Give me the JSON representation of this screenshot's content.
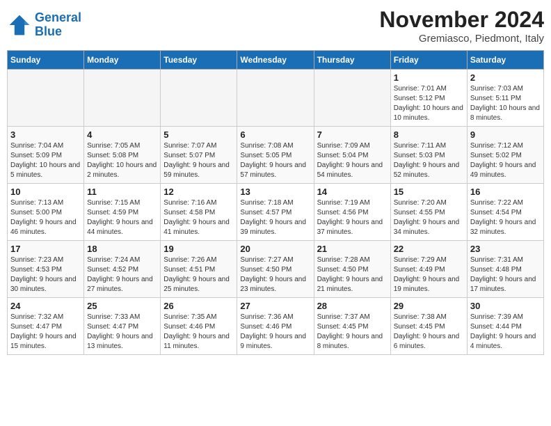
{
  "logo": {
    "line1": "General",
    "line2": "Blue"
  },
  "title": "November 2024",
  "subtitle": "Gremiasco, Piedmont, Italy",
  "weekdays": [
    "Sunday",
    "Monday",
    "Tuesday",
    "Wednesday",
    "Thursday",
    "Friday",
    "Saturday"
  ],
  "weeks": [
    [
      {
        "day": "",
        "info": ""
      },
      {
        "day": "",
        "info": ""
      },
      {
        "day": "",
        "info": ""
      },
      {
        "day": "",
        "info": ""
      },
      {
        "day": "",
        "info": ""
      },
      {
        "day": "1",
        "info": "Sunrise: 7:01 AM\nSunset: 5:12 PM\nDaylight: 10 hours and 10 minutes."
      },
      {
        "day": "2",
        "info": "Sunrise: 7:03 AM\nSunset: 5:11 PM\nDaylight: 10 hours and 8 minutes."
      }
    ],
    [
      {
        "day": "3",
        "info": "Sunrise: 7:04 AM\nSunset: 5:09 PM\nDaylight: 10 hours and 5 minutes."
      },
      {
        "day": "4",
        "info": "Sunrise: 7:05 AM\nSunset: 5:08 PM\nDaylight: 10 hours and 2 minutes."
      },
      {
        "day": "5",
        "info": "Sunrise: 7:07 AM\nSunset: 5:07 PM\nDaylight: 9 hours and 59 minutes."
      },
      {
        "day": "6",
        "info": "Sunrise: 7:08 AM\nSunset: 5:05 PM\nDaylight: 9 hours and 57 minutes."
      },
      {
        "day": "7",
        "info": "Sunrise: 7:09 AM\nSunset: 5:04 PM\nDaylight: 9 hours and 54 minutes."
      },
      {
        "day": "8",
        "info": "Sunrise: 7:11 AM\nSunset: 5:03 PM\nDaylight: 9 hours and 52 minutes."
      },
      {
        "day": "9",
        "info": "Sunrise: 7:12 AM\nSunset: 5:02 PM\nDaylight: 9 hours and 49 minutes."
      }
    ],
    [
      {
        "day": "10",
        "info": "Sunrise: 7:13 AM\nSunset: 5:00 PM\nDaylight: 9 hours and 46 minutes."
      },
      {
        "day": "11",
        "info": "Sunrise: 7:15 AM\nSunset: 4:59 PM\nDaylight: 9 hours and 44 minutes."
      },
      {
        "day": "12",
        "info": "Sunrise: 7:16 AM\nSunset: 4:58 PM\nDaylight: 9 hours and 41 minutes."
      },
      {
        "day": "13",
        "info": "Sunrise: 7:18 AM\nSunset: 4:57 PM\nDaylight: 9 hours and 39 minutes."
      },
      {
        "day": "14",
        "info": "Sunrise: 7:19 AM\nSunset: 4:56 PM\nDaylight: 9 hours and 37 minutes."
      },
      {
        "day": "15",
        "info": "Sunrise: 7:20 AM\nSunset: 4:55 PM\nDaylight: 9 hours and 34 minutes."
      },
      {
        "day": "16",
        "info": "Sunrise: 7:22 AM\nSunset: 4:54 PM\nDaylight: 9 hours and 32 minutes."
      }
    ],
    [
      {
        "day": "17",
        "info": "Sunrise: 7:23 AM\nSunset: 4:53 PM\nDaylight: 9 hours and 30 minutes."
      },
      {
        "day": "18",
        "info": "Sunrise: 7:24 AM\nSunset: 4:52 PM\nDaylight: 9 hours and 27 minutes."
      },
      {
        "day": "19",
        "info": "Sunrise: 7:26 AM\nSunset: 4:51 PM\nDaylight: 9 hours and 25 minutes."
      },
      {
        "day": "20",
        "info": "Sunrise: 7:27 AM\nSunset: 4:50 PM\nDaylight: 9 hours and 23 minutes."
      },
      {
        "day": "21",
        "info": "Sunrise: 7:28 AM\nSunset: 4:50 PM\nDaylight: 9 hours and 21 minutes."
      },
      {
        "day": "22",
        "info": "Sunrise: 7:29 AM\nSunset: 4:49 PM\nDaylight: 9 hours and 19 minutes."
      },
      {
        "day": "23",
        "info": "Sunrise: 7:31 AM\nSunset: 4:48 PM\nDaylight: 9 hours and 17 minutes."
      }
    ],
    [
      {
        "day": "24",
        "info": "Sunrise: 7:32 AM\nSunset: 4:47 PM\nDaylight: 9 hours and 15 minutes."
      },
      {
        "day": "25",
        "info": "Sunrise: 7:33 AM\nSunset: 4:47 PM\nDaylight: 9 hours and 13 minutes."
      },
      {
        "day": "26",
        "info": "Sunrise: 7:35 AM\nSunset: 4:46 PM\nDaylight: 9 hours and 11 minutes."
      },
      {
        "day": "27",
        "info": "Sunrise: 7:36 AM\nSunset: 4:46 PM\nDaylight: 9 hours and 9 minutes."
      },
      {
        "day": "28",
        "info": "Sunrise: 7:37 AM\nSunset: 4:45 PM\nDaylight: 9 hours and 8 minutes."
      },
      {
        "day": "29",
        "info": "Sunrise: 7:38 AM\nSunset: 4:45 PM\nDaylight: 9 hours and 6 minutes."
      },
      {
        "day": "30",
        "info": "Sunrise: 7:39 AM\nSunset: 4:44 PM\nDaylight: 9 hours and 4 minutes."
      }
    ]
  ]
}
